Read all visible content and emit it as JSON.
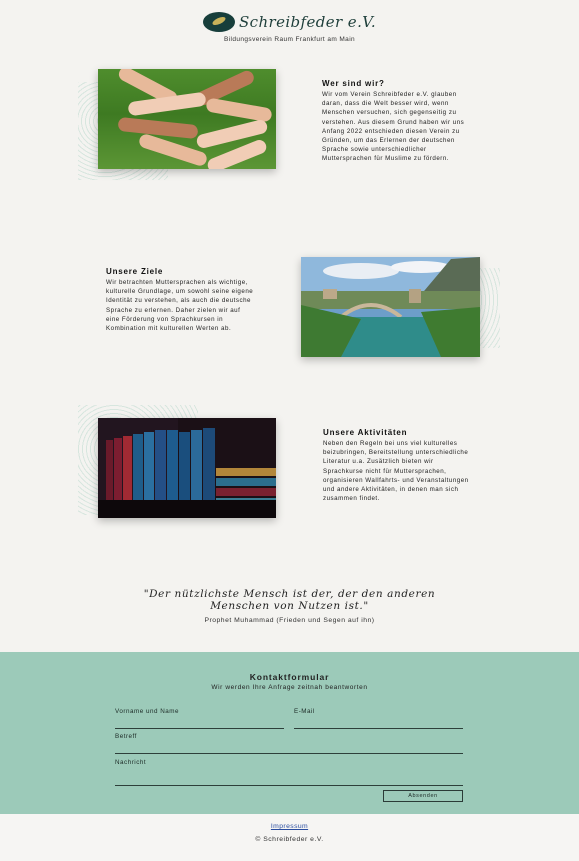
{
  "header": {
    "logo_text": "Schreibfeder e.V.",
    "subtitle": "Bildungsverein Raum Frankfurt am Main"
  },
  "sections": [
    {
      "title": "Wer sind wir?",
      "text": "Wir vom Verein Schreibfeder e.V. glauben daran, dass die Welt besser wird, wenn Menschen versuchen, sich gegenseitig zu verstehen. Aus diesem Grund haben wir uns Anfang 2022 entschieden diesen Verein zu Gründen, um das Erlernen der deutschen Sprache sowie unterschiedlicher Muttersprachen für Muslime zu fördern."
    },
    {
      "title": "Unsere Ziele",
      "text": "Wir betrachten Muttersprachen als wichtige, kulturelle Grundlage, um sowohl seine eigene Identität zu verstehen, als auch die deutsche Sprache zu erlernen. Daher zielen wir auf eine Förderung von Sprachkursen in Kombination mit kulturellen Werten ab."
    },
    {
      "title": "Unsere Aktivitäten",
      "text": "Neben den Regeln bei uns viel kulturelles beizubringen, Bereitstellung unterschiedliche Literatur u.a. Zusätzlich bieten wir Sprachkurse nicht für Muttersprachen, organisieren Wallfahrts- und Veranstaltungen und andere Aktivitäten, in denen man sich zusammen findet."
    }
  ],
  "quote": {
    "text": "\"Der nützlichste Mensch ist der, der den anderen Menschen von Nutzen ist.\"",
    "source": "Prophet Muhammad (Frieden und Segen auf ihn)"
  },
  "contact": {
    "title": "Kontaktformular",
    "subtitle": "Wir werden Ihre Anfrage zeitnah beantworten",
    "fields": {
      "name": "Vorname und Name",
      "email": "E-Mail",
      "subject": "Betreff",
      "message": "Nachricht"
    },
    "send_label": "Absenden"
  },
  "footer": {
    "impressum": "Impressum",
    "copyright": "© Schreibfeder e.V."
  },
  "colors": {
    "contact_bg": "#9ccab9",
    "logo": "#173e3b",
    "link": "#2a4da0"
  }
}
